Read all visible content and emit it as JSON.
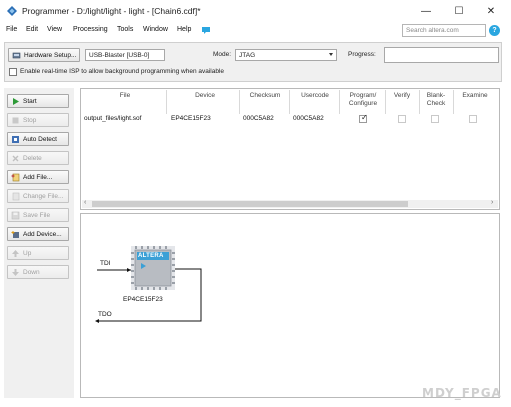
{
  "window": {
    "title": "Programmer - D:/light/light - light - [Chain6.cdf]*",
    "minimize_glyph": "—",
    "maximize_glyph": "☐",
    "close_glyph": "✕"
  },
  "menu": {
    "items": [
      "File",
      "Edit",
      "View",
      "Processing",
      "Tools",
      "Window",
      "Help"
    ],
    "search_placeholder": "Search altera.com"
  },
  "hardware": {
    "setup_button": "Hardware Setup...",
    "device_field": "USB-Blaster [USB-0]",
    "mode_label": "Mode:",
    "mode_value": "JTAG",
    "progress_label": "Progress:",
    "progress_value": "",
    "isp_checkbox_label": "Enable real-time ISP to allow background programming when available",
    "isp_checked": false
  },
  "left_buttons": [
    {
      "label": "Start",
      "enabled": true,
      "icon": "play-icon"
    },
    {
      "label": "Stop",
      "enabled": false,
      "icon": "stop-icon"
    },
    {
      "label": "Auto Detect",
      "enabled": true,
      "icon": "auto-detect-icon"
    },
    {
      "label": "Delete",
      "enabled": false,
      "icon": "delete-icon"
    },
    {
      "label": "Add File...",
      "enabled": true,
      "icon": "add-file-icon"
    },
    {
      "label": "Change File...",
      "enabled": false,
      "icon": "change-file-icon"
    },
    {
      "label": "Save File",
      "enabled": false,
      "icon": "save-file-icon"
    },
    {
      "label": "Add Device...",
      "enabled": true,
      "icon": "add-device-icon"
    },
    {
      "label": "Up",
      "enabled": false,
      "icon": "up-icon"
    },
    {
      "label": "Down",
      "enabled": false,
      "icon": "down-icon"
    }
  ],
  "table": {
    "headers": [
      "File",
      "Device",
      "Checksum",
      "Usercode",
      "Program/\nConfigure",
      "Verify",
      "Blank-\nCheck",
      "Examine"
    ],
    "rows": [
      {
        "file": "output_files/light.sof",
        "device": "EP4CE15F23",
        "checksum": "000C5A82",
        "usercode": "000C5A82",
        "program": true,
        "verify": false,
        "blank_check": false,
        "examine": false
      }
    ]
  },
  "chain": {
    "chip_brand": "ALTERA",
    "device_name": "EP4CE15F23",
    "tdi_label": "TDI",
    "tdo_label": "TDO"
  },
  "watermark": "MDY_FPGA",
  "colors": {
    "help_blue": "#2aa6e0",
    "chip_blue": "#3ba0d6",
    "chip_grey": "#b8bcc2"
  }
}
